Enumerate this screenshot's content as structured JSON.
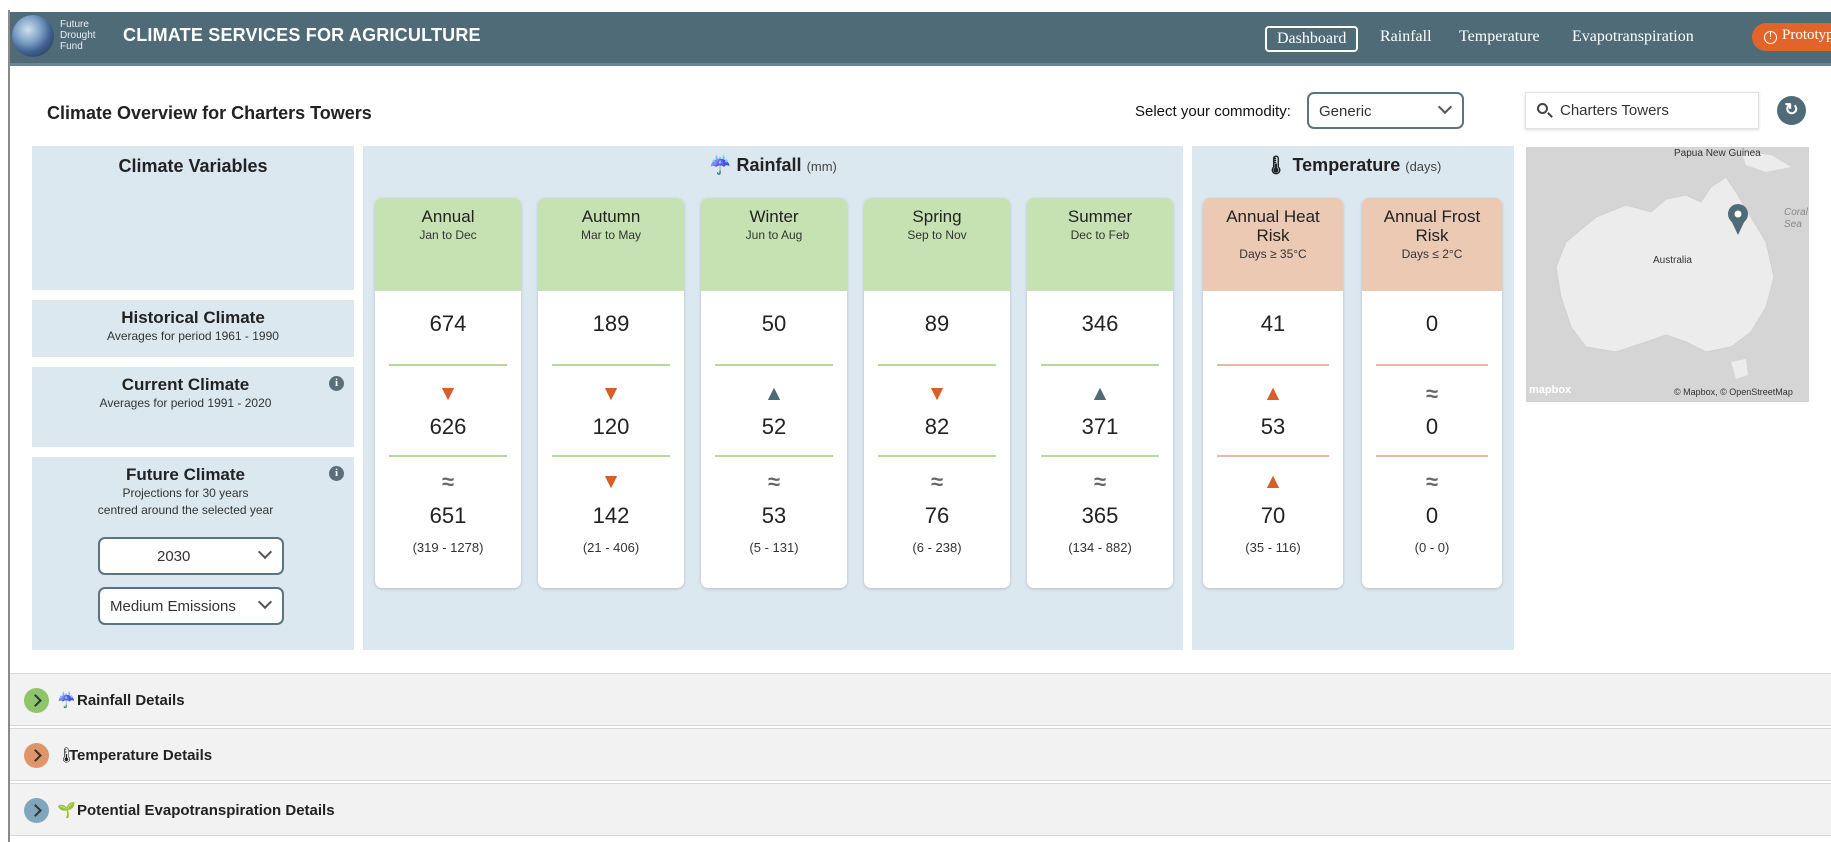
{
  "header": {
    "logo_text": [
      "Future",
      "Drought",
      "Fund"
    ],
    "title": "CLIMATE SERVICES FOR AGRICULTURE",
    "nav": [
      "Dashboard",
      "Rainfall",
      "Temperature",
      "Evapotranspiration"
    ],
    "active_nav": "Dashboard",
    "badge": "Prototype"
  },
  "overview": {
    "title": "Climate Overview for Charters Towers",
    "commodity_label": "Select your commodity:",
    "commodity_value": "Generic",
    "search_value": "Charters Towers"
  },
  "variables": {
    "title": "Climate Variables",
    "historical": {
      "title": "Historical Climate",
      "subtitle": "Averages for period 1961 - 1990"
    },
    "current": {
      "title": "Current Climate",
      "subtitle": "Averages for period 1991 - 2020"
    },
    "future": {
      "title": "Future Climate",
      "subtitle1": "Projections for 30 years",
      "subtitle2": "centred around the selected year",
      "year": "2030",
      "emissions": "Medium Emissions"
    }
  },
  "rainfall": {
    "title": "Rainfall",
    "unit": "(mm)",
    "cards": [
      {
        "name": "Annual",
        "range": "Jan to Dec",
        "historical": "674",
        "current_trend": "down",
        "current": "626",
        "future_trend": "approx",
        "future": "651",
        "future_range": "(319 - 1278)"
      },
      {
        "name": "Autumn",
        "range": "Mar to May",
        "historical": "189",
        "current_trend": "down",
        "current": "120",
        "future_trend": "down",
        "future": "142",
        "future_range": "(21 - 406)"
      },
      {
        "name": "Winter",
        "range": "Jun to Aug",
        "historical": "50",
        "current_trend": "up",
        "current": "52",
        "future_trend": "approx",
        "future": "53",
        "future_range": "(5 - 131)"
      },
      {
        "name": "Spring",
        "range": "Sep to Nov",
        "historical": "89",
        "current_trend": "down",
        "current": "82",
        "future_trend": "approx",
        "future": "76",
        "future_range": "(6 - 238)"
      },
      {
        "name": "Summer",
        "range": "Dec to Feb",
        "historical": "346",
        "current_trend": "up",
        "current": "371",
        "future_trend": "approx",
        "future": "365",
        "future_range": "(134 - 882)"
      }
    ]
  },
  "temperature": {
    "title": "Temperature",
    "unit": "(days)",
    "cards": [
      {
        "name": "Annual Heat Risk",
        "range": "Days ≥ 35°C",
        "historical": "41",
        "current_trend": "up",
        "current": "53",
        "future_trend": "up",
        "future": "70",
        "future_range": "(35 - 116)"
      },
      {
        "name": "Annual Frost Risk",
        "range": "Days ≤ 2°C",
        "historical": "0",
        "current_trend": "approx",
        "current": "0",
        "future_trend": "approx",
        "future": "0",
        "future_range": "(0 - 0)"
      }
    ]
  },
  "map": {
    "labels": {
      "png": "Papua New Guinea",
      "country": "Australia",
      "sea": "Coral Sea"
    },
    "attribution_logo": "mapbox",
    "attribution": "© Mapbox, © OpenStreetMap"
  },
  "accordions": [
    {
      "label": "Rainfall Details",
      "icon": "cloud-rain-icon",
      "color": "#8cc56a"
    },
    {
      "label": "Temperature Details",
      "icon": "thermometer-icon",
      "color": "#e0946a"
    },
    {
      "label": "Potential Evapotranspiration Details",
      "icon": "seedling-icon",
      "color": "#7fa6ba"
    }
  ],
  "colors": {
    "header": "#4f6b78",
    "panel": "#dbe8f0",
    "rain_header": "#c6e2b3",
    "temp_header": "#ecc9b3",
    "trend_warm": "#d95f2a",
    "trend_cool": "#4f6b78",
    "badge": "#e2642a"
  }
}
